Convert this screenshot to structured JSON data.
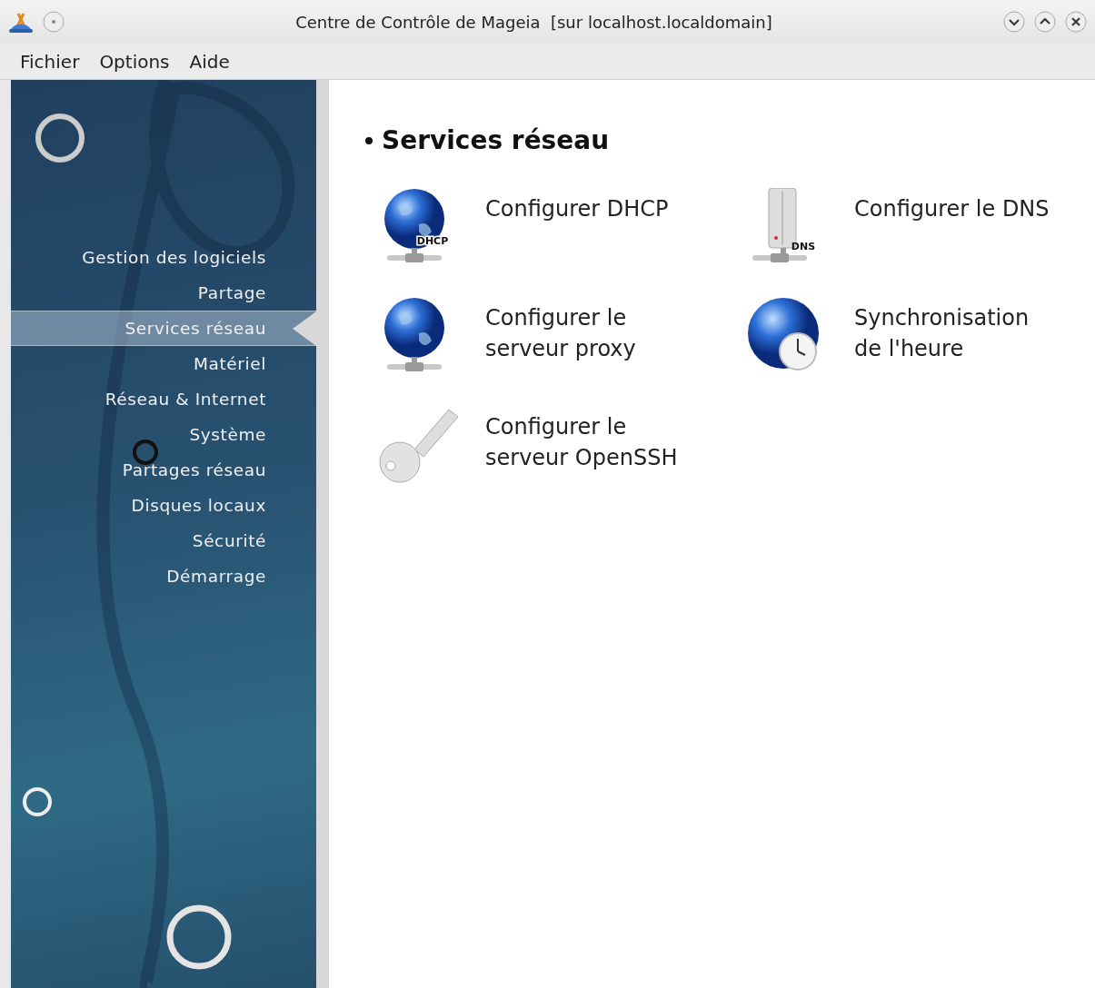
{
  "window": {
    "title": "Centre de Contrôle de Mageia  [sur localhost.localdomain]"
  },
  "menu_bar": [
    {
      "label": "Fichier"
    },
    {
      "label": "Options"
    },
    {
      "label": "Aide"
    }
  ],
  "sidebar": {
    "items": [
      {
        "label": "Gestion des logiciels",
        "selected": false
      },
      {
        "label": "Partage",
        "selected": false
      },
      {
        "label": "Services réseau",
        "selected": true
      },
      {
        "label": "Matériel",
        "selected": false
      },
      {
        "label": "Réseau & Internet",
        "selected": false
      },
      {
        "label": "Système",
        "selected": false
      },
      {
        "label": "Partages réseau",
        "selected": false
      },
      {
        "label": "Disques locaux",
        "selected": false
      },
      {
        "label": "Sécurité",
        "selected": false
      },
      {
        "label": "Démarrage",
        "selected": false
      }
    ]
  },
  "content": {
    "heading": "Services réseau",
    "tools": [
      {
        "kind": "globe-network",
        "badge": "DHCP",
        "label": "Configurer DHCP"
      },
      {
        "kind": "server",
        "badge": "DNS",
        "label": "Configurer le DNS"
      },
      {
        "kind": "globe-network",
        "label": "Configurer le serveur proxy"
      },
      {
        "kind": "globe-clock",
        "label": "Synchronisation de l'heure"
      },
      {
        "kind": "key",
        "label": "Configurer le serveur OpenSSH"
      }
    ]
  }
}
